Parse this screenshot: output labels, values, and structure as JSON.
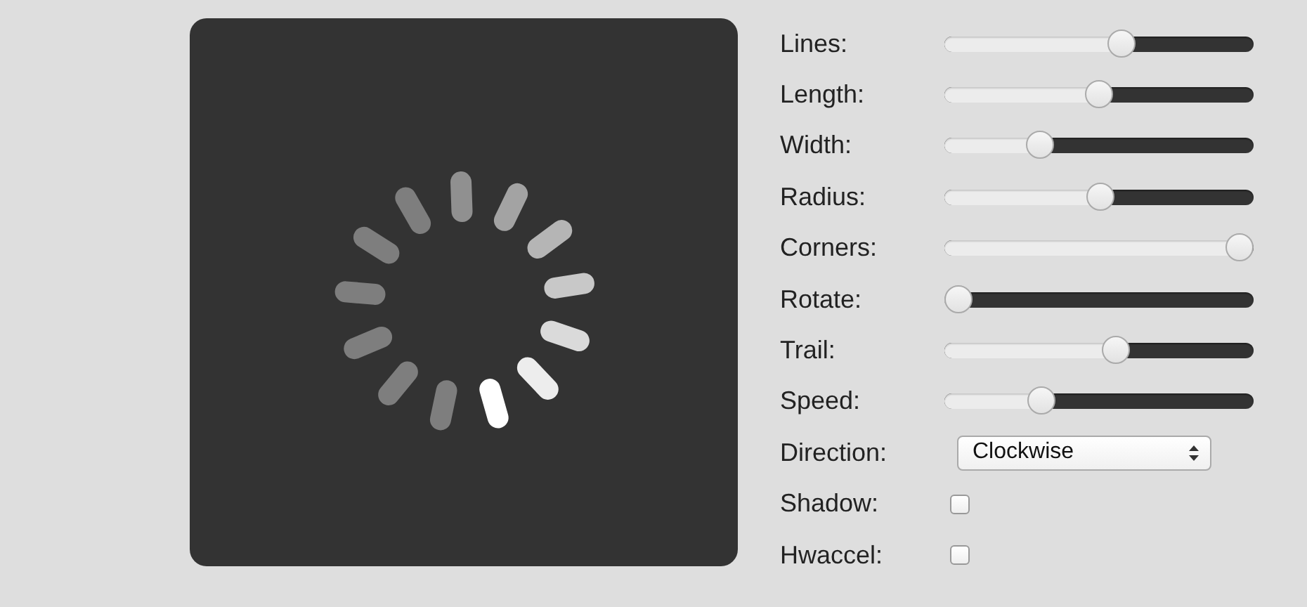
{
  "controls": [
    {
      "kind": "slider",
      "label": "Lines:",
      "level": 0.58
    },
    {
      "kind": "slider",
      "label": "Length:",
      "level": 0.5
    },
    {
      "kind": "slider",
      "label": "Width:",
      "level": 0.29
    },
    {
      "kind": "slider",
      "label": "Radius:",
      "level": 0.505
    },
    {
      "kind": "slider",
      "label": "Corners:",
      "level": 1
    },
    {
      "kind": "slider",
      "label": "Rotate:",
      "level": 0
    },
    {
      "kind": "slider",
      "label": "Trail:",
      "level": 0.56
    },
    {
      "kind": "slider",
      "label": "Speed:",
      "level": 0.295
    },
    {
      "kind": "select",
      "label": "Direction:",
      "value": "Clockwise"
    },
    {
      "kind": "checkbox",
      "label": "Shadow:",
      "checked": false
    },
    {
      "kind": "checkbox",
      "label": "Hwaccel:",
      "checked": false
    }
  ]
}
